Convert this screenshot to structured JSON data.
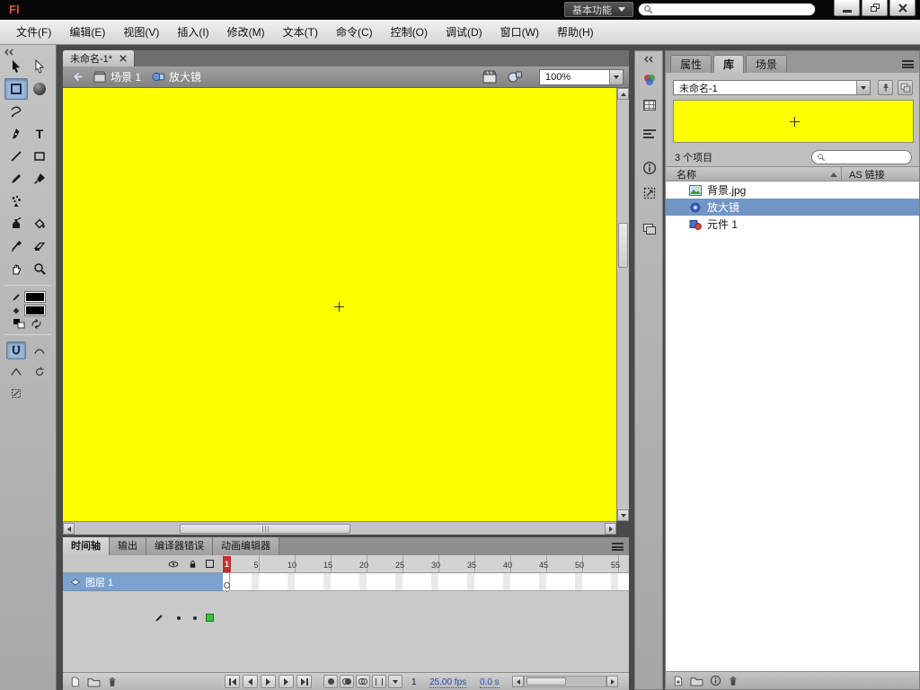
{
  "titlebar": {
    "logo": "Fl",
    "workspace_label": "基本功能"
  },
  "menubar": {
    "items": [
      "文件(F)",
      "编辑(E)",
      "视图(V)",
      "插入(I)",
      "修改(M)",
      "文本(T)",
      "命令(C)",
      "控制(O)",
      "调试(D)",
      "窗口(W)",
      "帮助(H)"
    ]
  },
  "toolbar": {
    "text_tool_glyph": "T",
    "active_tool": "free-transform",
    "tools": [
      "selection",
      "subselection",
      "free-transform",
      "3d-rotation",
      "lasso",
      "pen",
      "text",
      "line",
      "rectangle",
      "pencil",
      "brush",
      "deco",
      "ink-bottle",
      "paint-bucket",
      "eyedropper",
      "eraser",
      "hand",
      "zoom"
    ],
    "stroke_color": "#000000",
    "fill_color": "#000000",
    "active_option": "snap-to-objects"
  },
  "document": {
    "tab_title": "未命名-1*",
    "scene_name": "场景 1",
    "symbol_name": "放大镜",
    "zoom_level": "100%",
    "stage_color": "#ffff00"
  },
  "timeline": {
    "tabs": [
      "时间轴",
      "输出",
      "编译器错误",
      "动画编辑器"
    ],
    "active_tab": "时间轴",
    "layer_name": "图层 1",
    "ruler_numbers": [
      "5",
      "10",
      "15",
      "20",
      "25",
      "30",
      "35",
      "40",
      "45",
      "50",
      "55"
    ],
    "playhead_frame": "1",
    "current_frame": "1",
    "frame_rate": "25.00 fps",
    "elapsed_time": "0.0 s"
  },
  "dock_icons": [
    "color",
    "swatches",
    "align",
    "info",
    "transform",
    "library"
  ],
  "library": {
    "panel_tabs": [
      "属性",
      "库",
      "场景"
    ],
    "active_tab": "库",
    "document_name": "未命名-1",
    "item_count": "3 个项目",
    "name_column": "名称",
    "linkage_column": "AS 链接",
    "selected_item": "放大镜",
    "items": [
      {
        "name": "背景.jpg",
        "type": "bitmap"
      },
      {
        "name": "放大镜",
        "type": "movie-clip"
      },
      {
        "name": "元件 1",
        "type": "graphic"
      }
    ]
  },
  "colors": {
    "stage_yellow": "#ffff00",
    "selection_blue": "#7196c5",
    "playhead_red": "#c23030",
    "layer_row_blue": "#7ba2cf",
    "layer_outline_green": "#37c23c"
  }
}
